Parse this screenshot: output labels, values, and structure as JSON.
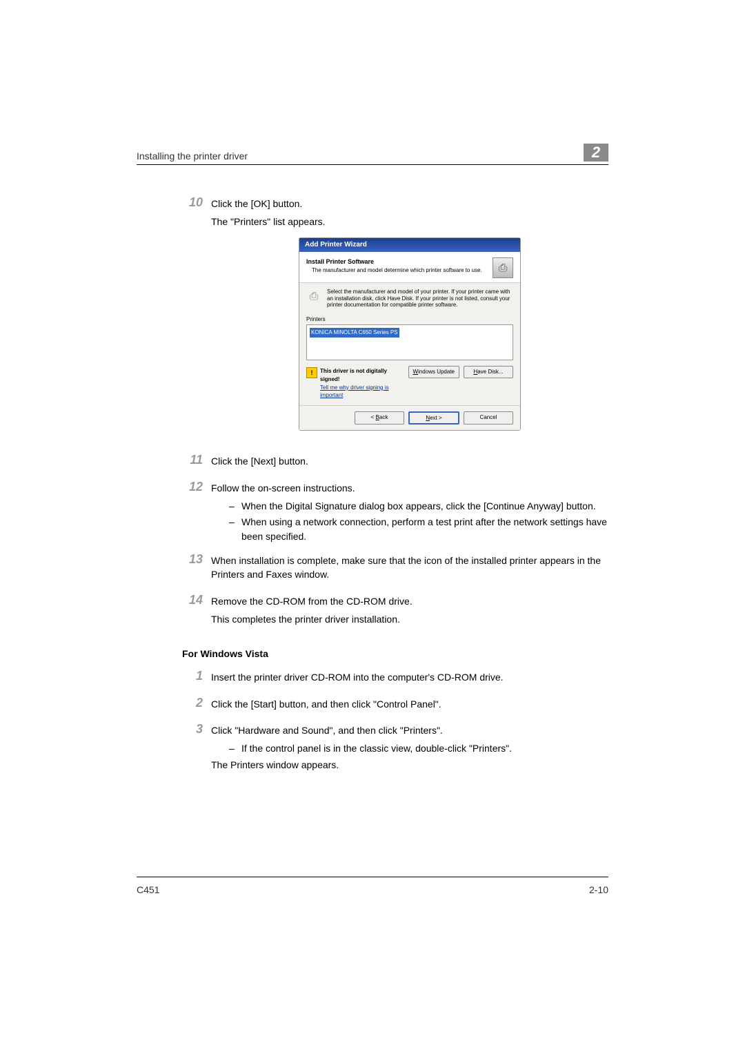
{
  "header": {
    "title": "Installing the printer driver",
    "chapter": "2"
  },
  "stepsA": [
    {
      "num": "10",
      "lines": [
        "Click the [OK] button.",
        "The \"Printers\" list appears."
      ]
    }
  ],
  "dialog": {
    "title": "Add Printer Wizard",
    "head_h": "Install Printer Software",
    "head_s": "The manufacturer and model determine which printer software to use.",
    "info": "Select the manufacturer and model of your printer. If your printer came with an installation disk, click Have Disk. If your printer is not listed, consult your printer documentation for compatible printer software.",
    "printers_label": "Printers",
    "printers_item": "KONICA MINOLTA C650 Series PS",
    "warn_bold": "This driver is not digitally signed!",
    "warn_link": "Tell me why driver signing is important",
    "btn_update_pre": "W",
    "btn_update_rest": "indows Update",
    "btn_have_pre": "H",
    "btn_have_rest": "ave Disk...",
    "btn_back_pre": "< ",
    "btn_back_u": "B",
    "btn_back_rest": "ack",
    "btn_next_u": "N",
    "btn_next_rest": "ext >",
    "btn_cancel": "Cancel"
  },
  "stepsB": [
    {
      "num": "11",
      "lines": [
        "Click the [Next] button."
      ]
    },
    {
      "num": "12",
      "lines": [
        "Follow the on-screen instructions."
      ],
      "subs": [
        {
          "text": "When the Digital Signature dialog box appears, click the [Continue Anyway] button."
        },
        {
          "text": "When using a network connection, perform a test print after the network settings have been specified."
        }
      ]
    },
    {
      "num": "13",
      "lines": [
        "When installation is complete, make sure that the icon of the installed printer appears in the Printers and Faxes window."
      ]
    },
    {
      "num": "14",
      "lines": [
        "Remove the CD-ROM from the CD-ROM drive.",
        "This completes the printer driver installation."
      ]
    }
  ],
  "sectionB": {
    "heading": "For Windows Vista",
    "steps": [
      {
        "num": "1",
        "lines": [
          "Insert the printer driver CD-ROM into the computer's CD-ROM drive."
        ]
      },
      {
        "num": "2",
        "lines": [
          "Click the [Start] button, and then click \"Control Panel\"."
        ]
      },
      {
        "num": "3",
        "lines": [
          "Click \"Hardware and Sound\", and then click \"Printers\"."
        ],
        "subs": [
          {
            "text": "If the control panel is in the classic view, double-click \"Printers\"."
          }
        ],
        "tail": [
          "The Printers window appears."
        ]
      }
    ]
  },
  "footer": {
    "left": "C451",
    "right": "2-10"
  }
}
